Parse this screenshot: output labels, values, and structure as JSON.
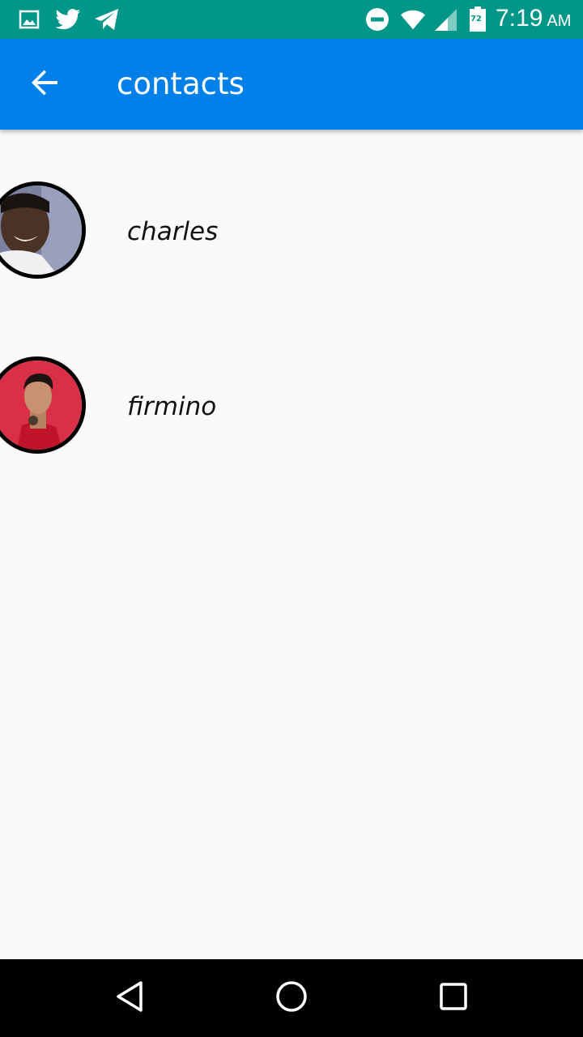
{
  "status_bar": {
    "time": "7:19",
    "ampm": "AM",
    "battery_level": "72",
    "color": "#009688",
    "left_icons": [
      "gallery-icon",
      "twitter-icon",
      "telegram-icon"
    ],
    "right_icons": [
      "do-not-disturb-icon",
      "wifi-icon",
      "cell-signal-icon",
      "battery-icon"
    ]
  },
  "app_bar": {
    "title": "contacts",
    "back_icon": "arrow-back-icon",
    "color": "#0080e8"
  },
  "contacts": [
    {
      "name": "charles",
      "avatar": "avatar-charles"
    },
    {
      "name": "firmino",
      "avatar": "avatar-firmino"
    }
  ],
  "nav_bar": {
    "buttons": [
      "back-triangle-icon",
      "home-circle-icon",
      "recents-square-icon"
    ]
  }
}
